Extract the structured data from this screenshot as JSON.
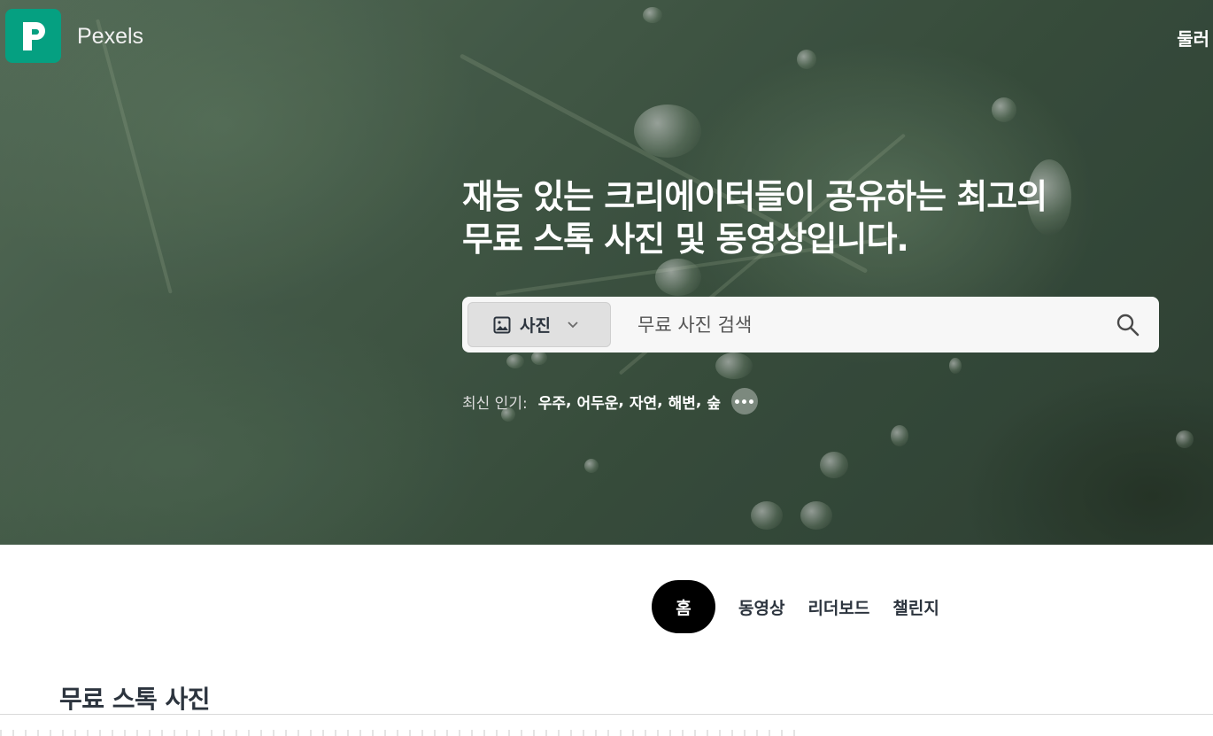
{
  "header": {
    "brand": "Pexels",
    "right_label": "둘러"
  },
  "hero": {
    "headline_line1": "재능 있는 크리에이터들이 공유하는 최고의",
    "headline_line2": "무료 스톡 사진 및 동영상입니다.",
    "search": {
      "type_label": "사진",
      "placeholder": "무료 사진 검색",
      "value": ""
    },
    "trending": {
      "label": "최신 인기:",
      "tags": [
        "우주",
        "어두운",
        "자연",
        "해변",
        "숲"
      ]
    }
  },
  "tabs": [
    {
      "label": "홈",
      "active": true
    },
    {
      "label": "동영상",
      "active": false
    },
    {
      "label": "리더보드",
      "active": false
    },
    {
      "label": "챌린지",
      "active": false
    }
  ],
  "main": {
    "section_title": "무료 스톡 사진"
  },
  "colors": {
    "brand": "#05a081",
    "tab_active_bg": "#000000"
  },
  "icons": [
    "pexels-logo-icon",
    "image-icon",
    "chevron-down-icon",
    "search-icon",
    "more-icon"
  ]
}
